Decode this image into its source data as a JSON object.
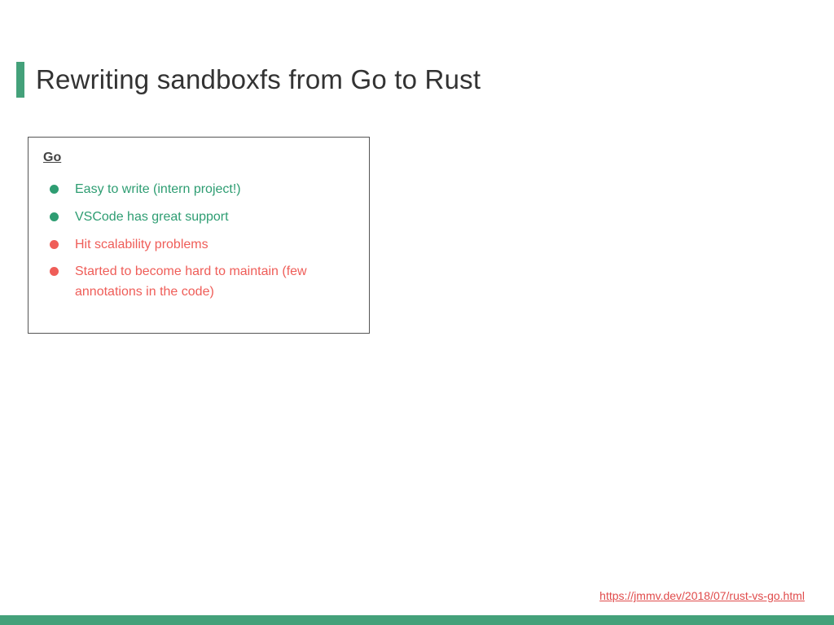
{
  "title": "Rewriting sandboxfs from Go to Rust",
  "card": {
    "header": "Go",
    "items": [
      {
        "tone": "pos",
        "text": "Easy to write (intern project!)"
      },
      {
        "tone": "pos",
        "text": "VSCode has great support"
      },
      {
        "tone": "neg",
        "text": "Hit scalability problems"
      },
      {
        "tone": "neg",
        "text": "Started to become hard to maintain (few annotations in the code)"
      }
    ]
  },
  "footer_link": "https://jmmv.dev/2018/07/rust-vs-go.html",
  "colors": {
    "accent": "#44a17a",
    "positive": "#2e9d72",
    "negative": "#ef5d58",
    "link": "#e04b4b"
  }
}
